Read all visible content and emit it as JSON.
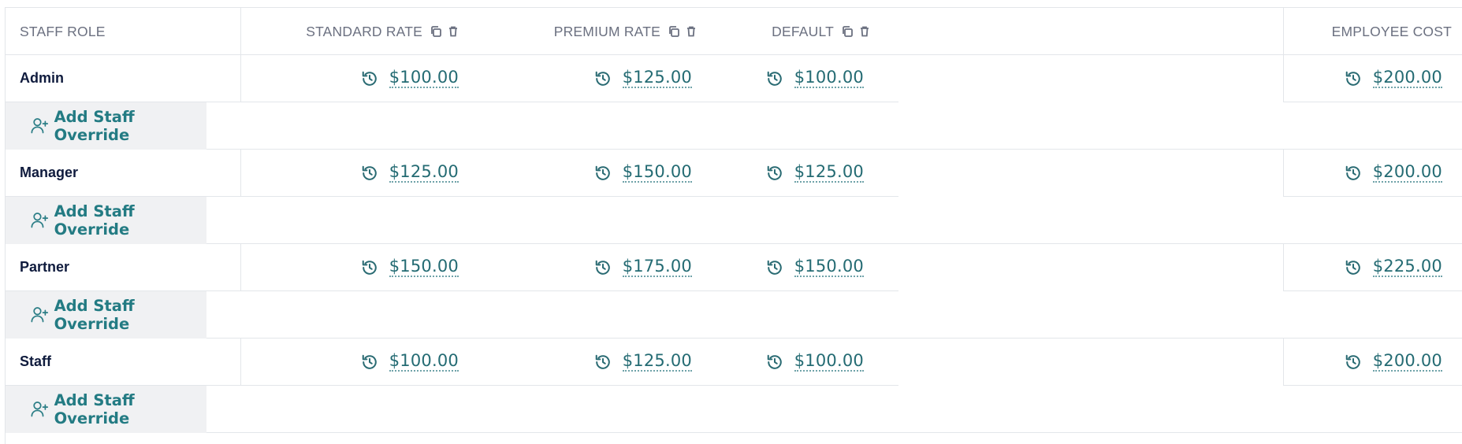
{
  "header": {
    "staff_role": "STAFF ROLE",
    "standard_rate": "STANDARD RATE",
    "premium_rate": "PREMIUM RATE",
    "default": "DEFAULT",
    "employee_cost": "EMPLOYEE COST"
  },
  "rows": [
    {
      "role": "Admin",
      "standard": "$100.00",
      "premium": "$125.00",
      "default": "$100.00",
      "employee_cost": "$200.00",
      "override_label": "Add Staff Override"
    },
    {
      "role": "Manager",
      "standard": "$125.00",
      "premium": "$150.00",
      "default": "$125.00",
      "employee_cost": "$200.00",
      "override_label": "Add Staff Override"
    },
    {
      "role": "Partner",
      "standard": "$150.00",
      "premium": "$175.00",
      "default": "$150.00",
      "employee_cost": "$225.00",
      "override_label": "Add Staff Override"
    },
    {
      "role": "Staff",
      "standard": "$100.00",
      "premium": "$125.00",
      "default": "$100.00",
      "employee_cost": "$200.00",
      "override_label": "Add Staff Override"
    }
  ],
  "icons": {
    "copy": "copy-icon",
    "delete": "trash-icon",
    "history": "history-icon",
    "add_user": "user-plus-icon"
  },
  "colors": {
    "accent": "#246b73",
    "header_text": "#6b7080",
    "role_text": "#0f1b3d",
    "override_bg": "#f0f1f3"
  }
}
